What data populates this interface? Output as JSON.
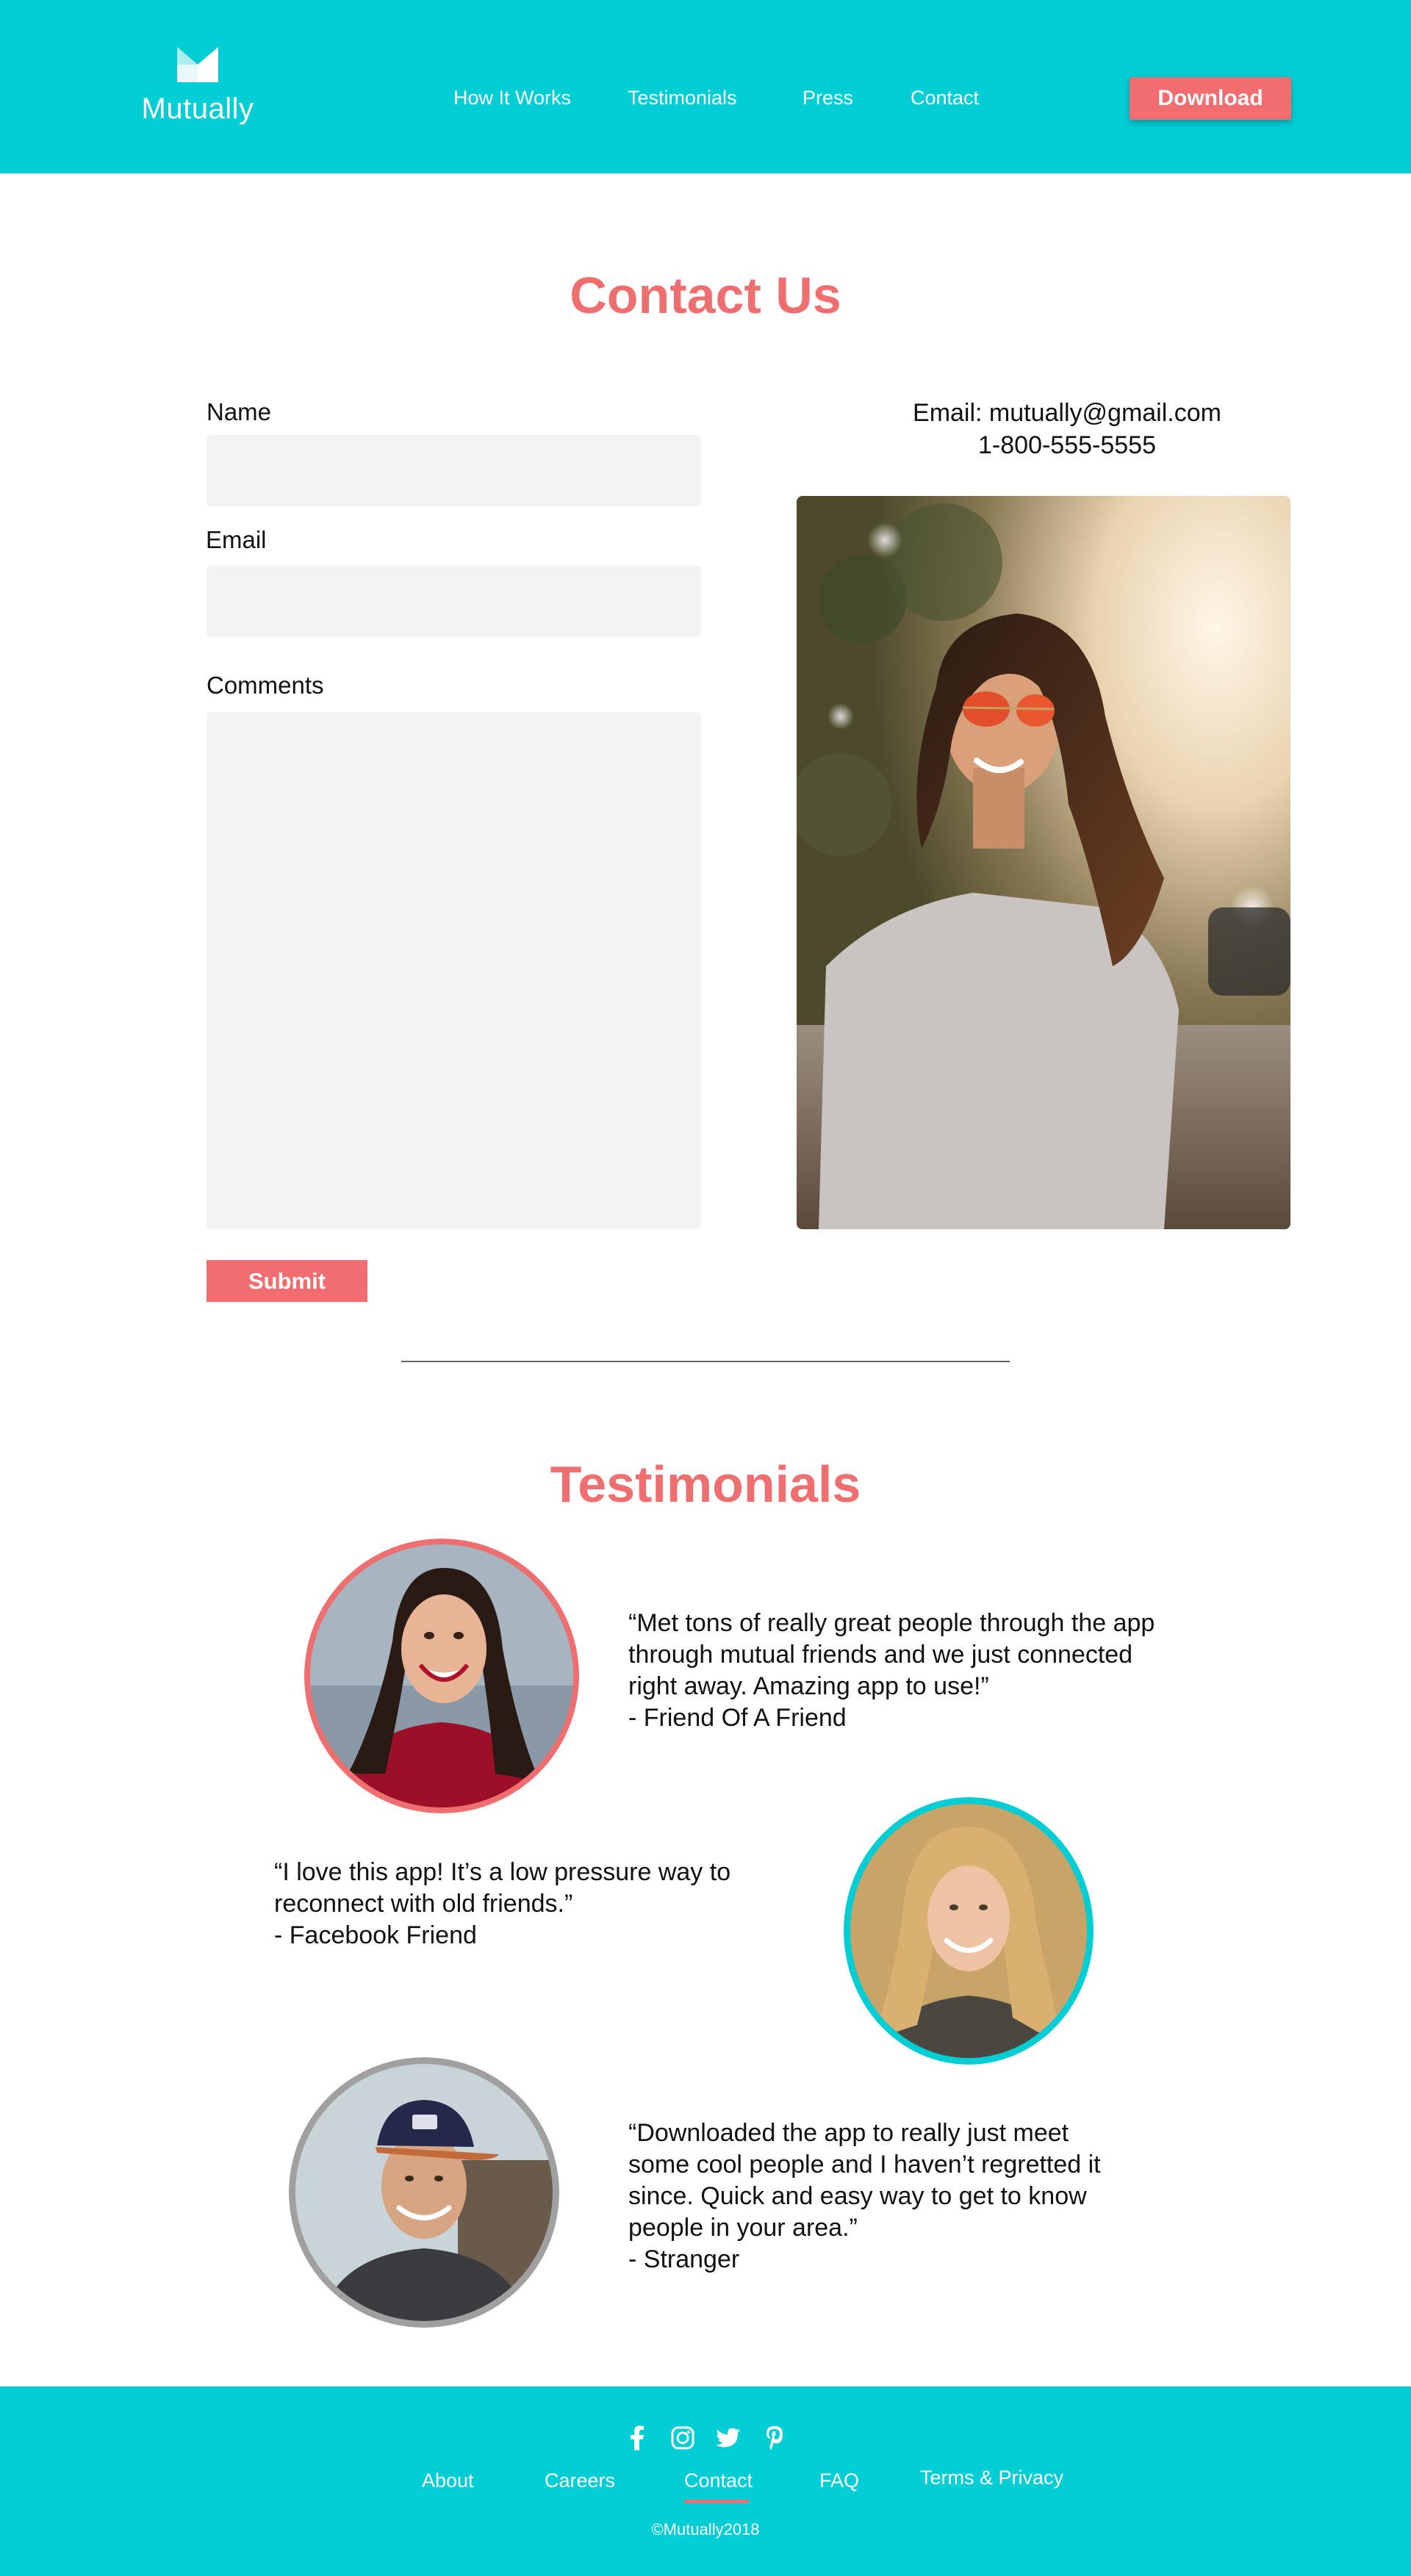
{
  "header": {
    "brand": "Mutually",
    "nav": [
      "How It Works",
      "Testimonials",
      "Press",
      "Contact"
    ],
    "download_label": "Download",
    "bg_color": "#00cdd4",
    "accent_color": "#f26d70"
  },
  "contact": {
    "title": "Contact Us",
    "name_label": "Name",
    "name_value": "",
    "email_label": "Email",
    "email_value": "",
    "comments_label": "Comments",
    "comments_value": "",
    "submit_label": "Submit",
    "email_line": "Email: mutually@gmail.com",
    "phone_line": "1-800-555-5555",
    "photo_icon": "woman-sunglasses-photo"
  },
  "testimonials": {
    "title": "Testimonials",
    "items": [
      {
        "lines": [
          "“Met tons of really great people through the app",
          "through mutual friends and we just connected",
          "right away. Amazing app to use!”"
        ],
        "author": "- Friend Of A Friend",
        "ring_color": "#ef6f70"
      },
      {
        "lines": [
          "“I love this app! It’s a low pressure way to",
          "reconnect with old friends.”"
        ],
        "author": "- Facebook Friend",
        "ring_color": "#00cdd4"
      },
      {
        "lines": [
          "“Downloaded the app to really just meet",
          "some cool people and I haven’t regretted it",
          "since. Quick and easy way to get to know",
          "people in your area.”"
        ],
        "author": "- Stranger",
        "ring_color": "#a0a0a0"
      }
    ]
  },
  "footer": {
    "social": [
      "facebook-icon",
      "instagram-icon",
      "twitter-icon",
      "pinterest-icon"
    ],
    "links": [
      "About",
      "Careers",
      "Contact",
      "FAQ",
      "Terms & Privacy"
    ],
    "active_link": "Contact",
    "copyright": "©Mutually2018"
  }
}
